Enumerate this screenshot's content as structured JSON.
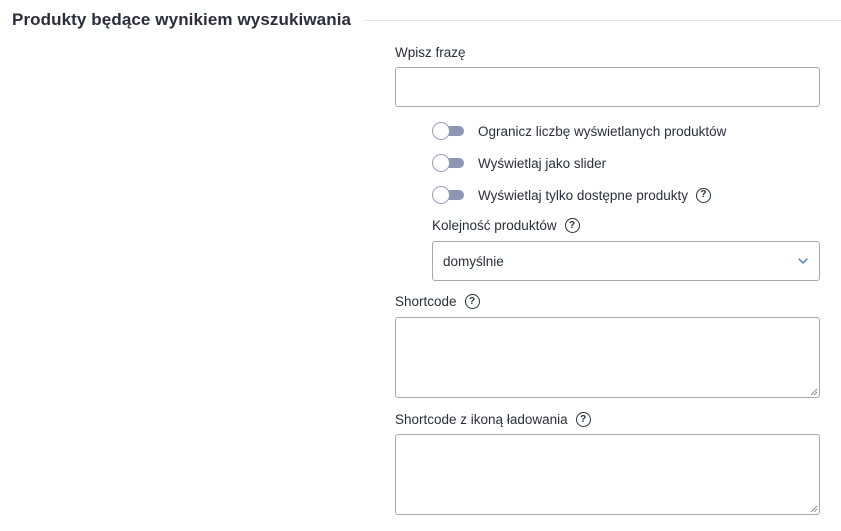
{
  "section": {
    "title": "Produkty będące wynikiem wyszukiwania"
  },
  "phrase": {
    "label": "Wpisz frazę",
    "value": ""
  },
  "toggles": [
    {
      "label": "Ogranicz liczbę wyświetlanych produktów",
      "on": false,
      "help": false
    },
    {
      "label": "Wyświetlaj jako slider",
      "on": false,
      "help": false
    },
    {
      "label": "Wyświetlaj tylko dostępne produkty",
      "on": false,
      "help": true
    }
  ],
  "order": {
    "label": "Kolejność produktów",
    "selected": "domyślnie"
  },
  "shortcode": {
    "label": "Shortcode",
    "value": ""
  },
  "shortcode_loading": {
    "label": "Shortcode z ikoną ładowania",
    "value": ""
  },
  "icons": {
    "help": "?",
    "help_name": "question-circle-icon",
    "select_arrow": "chevron-down-icon"
  },
  "colors": {
    "text": "#2a2e3a",
    "border": "#a5a9b4",
    "toggle_track": "#8f95b4",
    "select_arrow": "#4a78c8"
  }
}
